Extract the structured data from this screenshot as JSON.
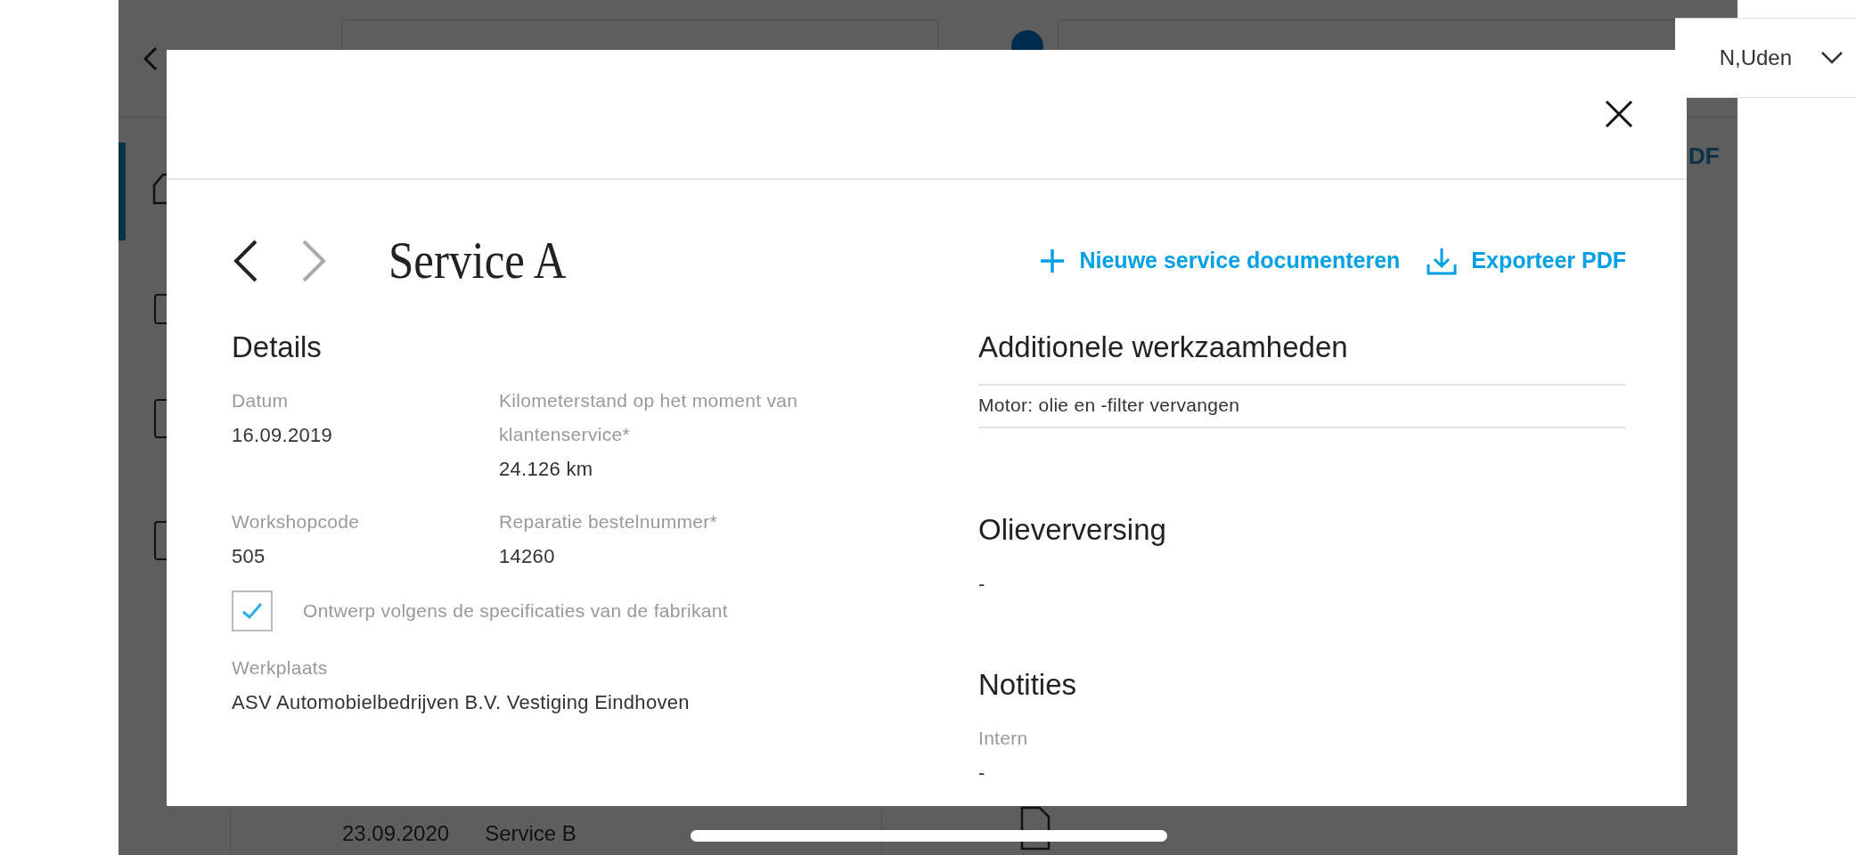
{
  "background": {
    "location": "N,Uden",
    "export_fragment": "DF",
    "history_row": {
      "date": "23.09.2020",
      "service": "Service B"
    }
  },
  "modal": {
    "navigation": {
      "previous_disabled": false,
      "next_disabled": true
    },
    "title": "Service A",
    "actions": [
      {
        "kind": "add",
        "label": "Nieuwe service documenteren"
      },
      {
        "kind": "export",
        "label": "Exporteer PDF"
      }
    ],
    "details": {
      "heading": "Details",
      "fields": [
        {
          "label": "Datum",
          "value": "16.09.2019"
        },
        {
          "label": "Kilometerstand op het moment van klantenservice*",
          "value": "24.126 km"
        },
        {
          "label": "Workshopcode",
          "value": "505"
        },
        {
          "label": "Reparatie bestelnummer*",
          "value": "14260"
        }
      ],
      "checkbox": {
        "label": "Ontwerp volgens de specificaties van de fabrikant",
        "checked": true
      },
      "workshop": {
        "label": "Werkplaats",
        "value": "ASV Automobielbedrijven B.V. Vestiging Eindhoven"
      }
    },
    "additional_work": {
      "heading": "Additionele werkzaamheden",
      "items": [
        "Motor: olie en -filter vervangen"
      ]
    },
    "oil_change": {
      "heading": "Olieverversing",
      "value": "-"
    },
    "notes": {
      "heading": "Notities",
      "fields": [
        {
          "label": "Intern",
          "value": "-"
        }
      ]
    }
  }
}
